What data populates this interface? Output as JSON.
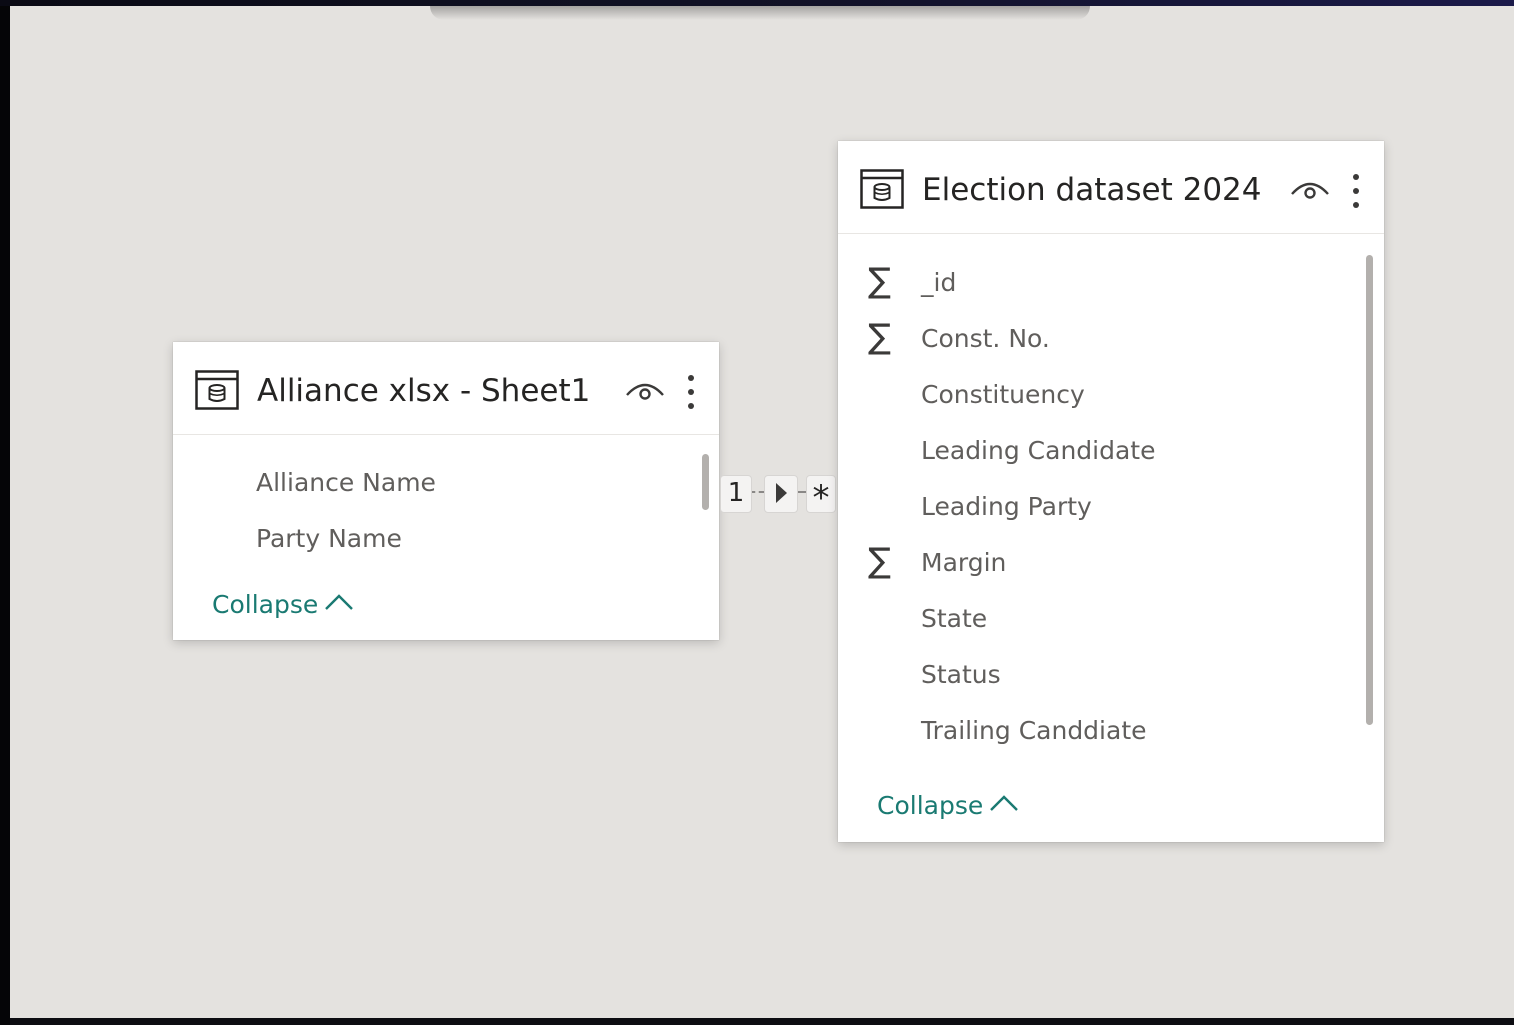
{
  "tables": [
    {
      "title": "Alliance xlsx - Sheet1",
      "icon": "table-icon",
      "fields": [
        {
          "name": "Alliance Name",
          "type": "text"
        },
        {
          "name": "Party Name",
          "type": "text"
        }
      ],
      "collapse_label": "Collapse"
    },
    {
      "title": "Election dataset 2024",
      "icon": "table-icon",
      "fields": [
        {
          "name": "_id",
          "type": "sum"
        },
        {
          "name": "Const. No.",
          "type": "sum"
        },
        {
          "name": "Constituency",
          "type": "text"
        },
        {
          "name": "Leading Candidate",
          "type": "text"
        },
        {
          "name": "Leading Party",
          "type": "text"
        },
        {
          "name": "Margin",
          "type": "sum"
        },
        {
          "name": "State",
          "type": "text"
        },
        {
          "name": "Status",
          "type": "text"
        },
        {
          "name": "Trailing Canddiate",
          "type": "text"
        }
      ],
      "collapse_label": "Collapse"
    }
  ],
  "relationship": {
    "from_cardinality": "1",
    "to_cardinality": "*",
    "direction_icon": "triangle-right-icon"
  },
  "colors": {
    "canvas": "#e4e2df",
    "collapse_link": "#1a7a72",
    "field_text": "#605e5c",
    "title_text": "#252423"
  }
}
